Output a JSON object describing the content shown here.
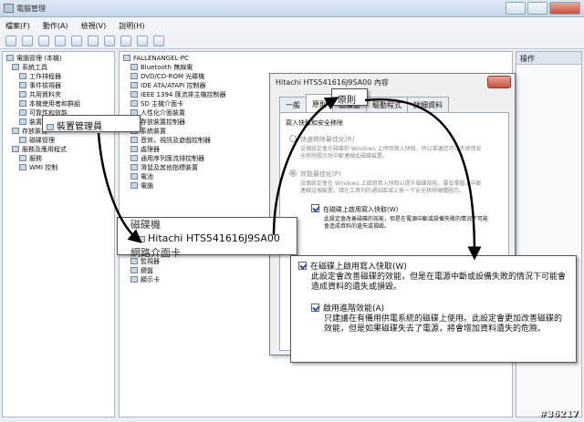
{
  "window": {
    "title": "電腦管理",
    "menu": [
      "檔案(F)",
      "動作(A)",
      "檢視(V)",
      "說明(H)"
    ]
  },
  "left_tree": [
    "電腦管理 (本機)",
    "系統工具",
    "工作排程器",
    "事件檢視器",
    "共用資料夾",
    "本機使用者和群組",
    "可靠性和效能",
    "裝置管理員",
    "存放裝置",
    "磁碟管理",
    "服務及應用程式",
    "服務",
    "WMI 控制"
  ],
  "device_tree": [
    "FALLENANGEL-PC",
    "Bluetooth 無線電",
    "DVD/CD-ROM 光碟機",
    "IDE ATA/ATAPI 控制器",
    "IEEE 1394 匯流排主機控制器",
    "SD 主機介面卡",
    "人性化介面裝置",
    "存放裝置控制器",
    "系統裝置",
    "音效，視訊及遊戲控制器",
    "處理器",
    "通用序列匯流排控制器",
    "滑鼠及其他指標裝置",
    "電池",
    "電腦",
    "監視器",
    "鍵盤",
    "顯示卡"
  ],
  "right_pane": {
    "header": "操作"
  },
  "callouts": {
    "device_manager": "裝置管理員",
    "disk_label": "磁碟機",
    "disk_name": "Hitachi HTS541616J9SA00",
    "network": "網路介面卡",
    "policy_tab": "原則"
  },
  "dialog": {
    "title": "Hitachi HTS541616J9SA00 內容",
    "tabs": [
      "一般",
      "原則",
      "磁碟區",
      "驅動程式",
      "詳細資料"
    ],
    "section": "寫入快取和安全移除",
    "opt1_title": "快速移除最佳化(R)",
    "opt1_desc": "這個設定會在磁碟和 Windows 上停用寫入快取，所以單讓您可以不使用安全移除圖示就中斷連線此磁碟裝置。",
    "opt2_title": "效能最佳化(P)",
    "opt2_desc": "這個設定會在 Windows 上啟用寫入快取以提升磁碟效能。要從電腦上中斷連線這個裝置，請在工具列的通知區域上按一下安全移除硬體圖示。",
    "cb1_small": "在磁碟上啟用寫入快取(W)",
    "cb1_small_desc": "此設定會改善磁碟的效能，但是在電源中斷或設備失敗的情況下可能會造成資料的遺失或損毀。"
  },
  "zoom": {
    "cb1_label": "在磁碟上啟用寫入快取(W)",
    "cb1_desc": "此設定會改善磁碟的效能，但是在電源中斷或設備失敗的情況下可能會造成資料的遺失或損毀。",
    "cb2_label": "啟用進階效能(A)",
    "cb2_desc": "只建議在有備用供電系統的磁碟上使用。此設定會更加改善磁碟的效能，但是如果磁碟失去了電源，將會增加資料遺失的危險。"
  },
  "watermark": "#36217",
  "colors": {
    "accent": "#2a4fa0",
    "highlight": "#316ac5"
  }
}
